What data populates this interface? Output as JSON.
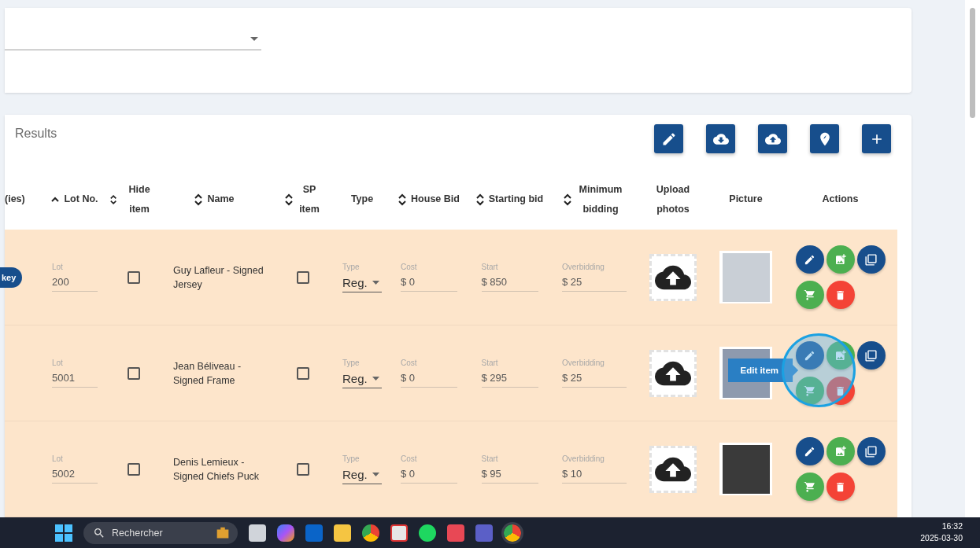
{
  "results": {
    "title": "Results",
    "toolbar": [
      {
        "kind": "edit"
      },
      {
        "kind": "download"
      },
      {
        "kind": "upload"
      },
      {
        "kind": "location"
      },
      {
        "kind": "add"
      }
    ]
  },
  "table": {
    "columns": [
      {
        "label": "(ies)",
        "sortable": false,
        "sorted": false
      },
      {
        "label": "Lot No.",
        "sortable": true,
        "sorted": true
      },
      {
        "label": "Hide item",
        "sortable": true,
        "sorted": false
      },
      {
        "label": "Name",
        "sortable": true,
        "sorted": false
      },
      {
        "label": "SP item",
        "sortable": true,
        "sorted": false
      },
      {
        "label": "Type",
        "sortable": false,
        "sorted": false
      },
      {
        "label": "House Bid",
        "sortable": true,
        "sorted": false
      },
      {
        "label": "Starting bid",
        "sortable": true,
        "sorted": false
      },
      {
        "label": "Minimum bidding",
        "sortable": true,
        "sorted": false
      },
      {
        "label": "Upload photos",
        "sortable": false,
        "sorted": false
      },
      {
        "label": "Picture",
        "sortable": false,
        "sorted": false
      },
      {
        "label": "Actions",
        "sortable": false,
        "sorted": false
      }
    ],
    "rows": [
      {
        "chip": "key",
        "lot_label": "Lot",
        "lot": "200",
        "hidden": false,
        "name": "Guy Lafleur - Signed Jersey",
        "sp_item": false,
        "type_label": "Type",
        "type": "Reg.",
        "cost_label": "Cost",
        "cost": "$ 0",
        "start_label": "Start",
        "start": "$ 850",
        "overbidding_label": "Overbidding",
        "overbidding": "$ 25"
      },
      {
        "lot_label": "Lot",
        "lot": "5001",
        "hidden": false,
        "name": "Jean Béliveau - Signed Frame",
        "sp_item": false,
        "type_label": "Type",
        "type": "Reg.",
        "cost_label": "Cost",
        "cost": "$ 0",
        "start_label": "Start",
        "start": "$ 295",
        "overbidding_label": "Overbidding",
        "overbidding": "$ 25",
        "tooltip": "Edit item"
      },
      {
        "lot_label": "Lot",
        "lot": "5002",
        "hidden": false,
        "name": "Denis Lemieux - Signed Chiefs Puck",
        "sp_item": false,
        "type_label": "Type",
        "type": "Reg.",
        "cost_label": "Cost",
        "cost": "$ 0",
        "start_label": "Start",
        "start": "$ 95",
        "overbidding_label": "Overbidding",
        "overbidding": "$ 10"
      }
    ]
  },
  "taskbar": {
    "search_placeholder": "Rechercher",
    "time": "16:32",
    "date": "2025-03-30"
  }
}
